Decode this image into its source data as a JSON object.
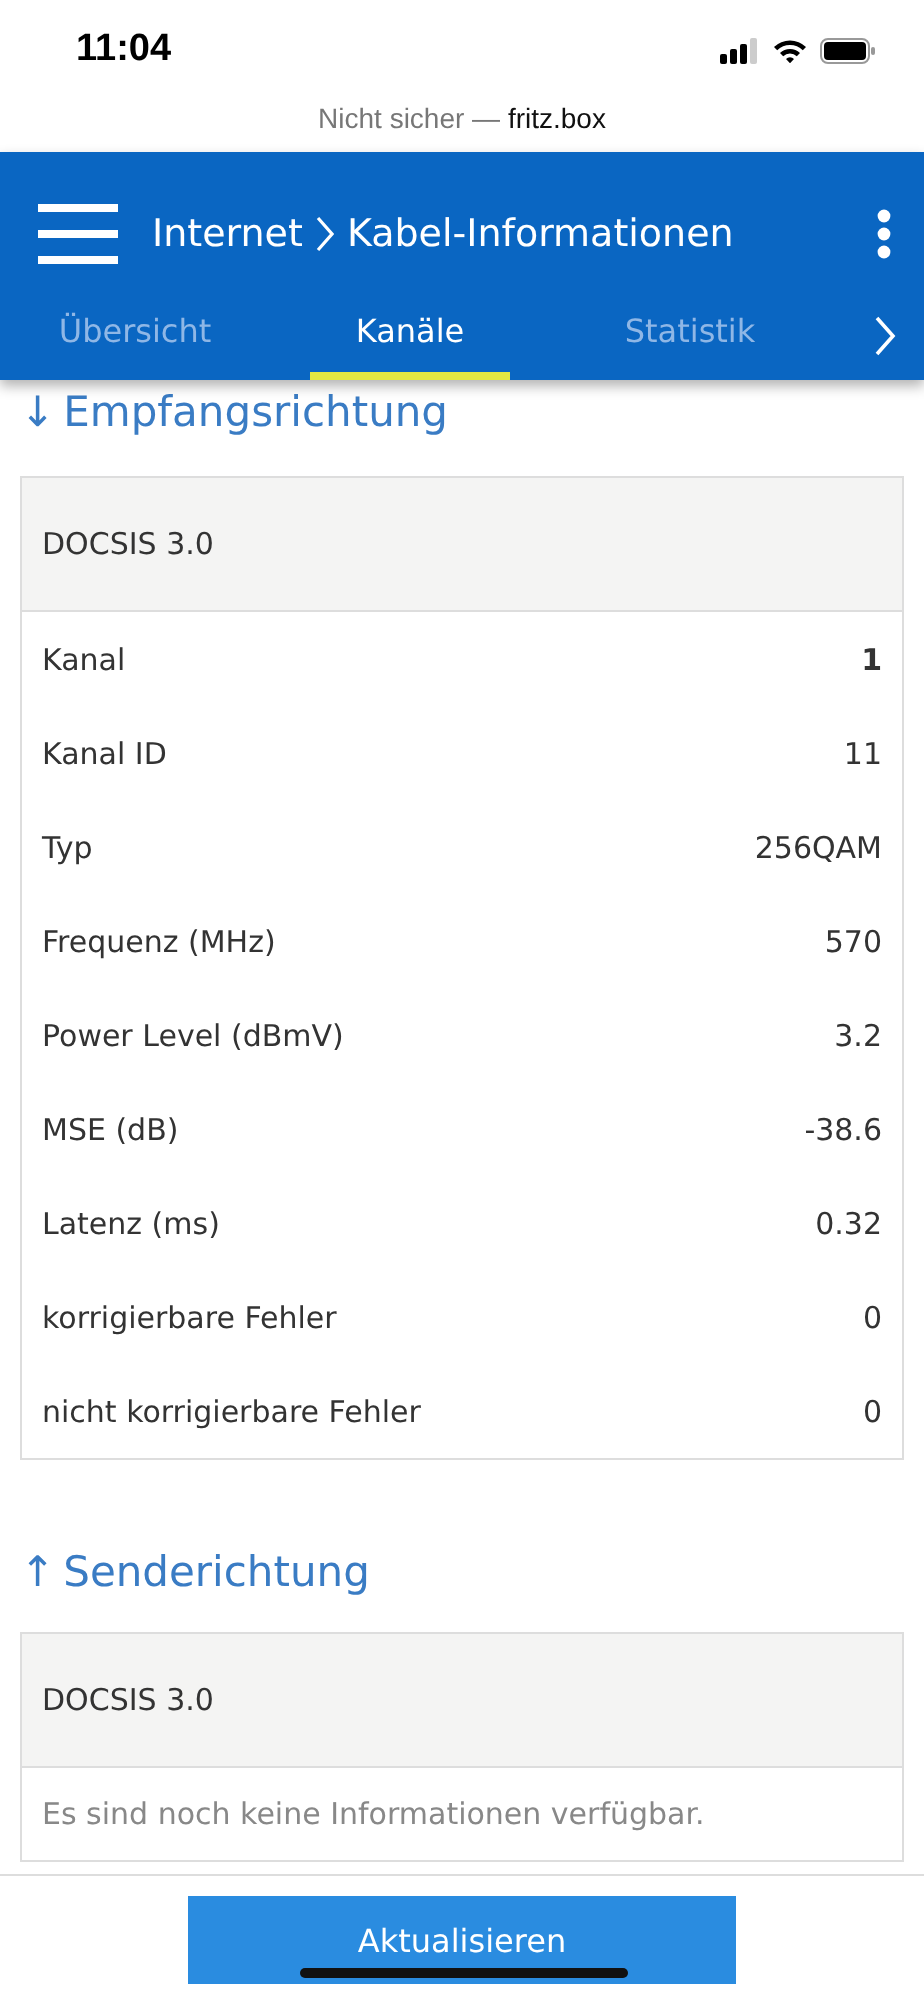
{
  "status_bar": {
    "time": "11:04"
  },
  "url_bar": {
    "prefix": "Nicht sicher —",
    "host": "fritz.box"
  },
  "header": {
    "breadcrumb": [
      "Internet",
      "Kabel-Informationen"
    ]
  },
  "tabs": [
    {
      "label": "Übersicht",
      "selected": false
    },
    {
      "label": "Kanäle",
      "selected": true
    },
    {
      "label": "Statistik",
      "selected": false
    }
  ],
  "sections": [
    {
      "arrow": "↓",
      "title": "Empfangsrichtung",
      "table_title": "DOCSIS 3.0",
      "rows": [
        {
          "label": "Kanal",
          "value": "1",
          "bold": true
        },
        {
          "label": "Kanal ID",
          "value": "11",
          "bold": false
        },
        {
          "label": "Typ",
          "value": "256QAM",
          "bold": false
        },
        {
          "label": "Frequenz (MHz)",
          "value": "570",
          "bold": false
        },
        {
          "label": "Power Level (dBmV)",
          "value": "3.2",
          "bold": false
        },
        {
          "label": "MSE (dB)",
          "value": "-38.6",
          "bold": false
        },
        {
          "label": "Latenz (ms)",
          "value": "0.32",
          "bold": false
        },
        {
          "label": "korrigierbare Fehler",
          "value": "0",
          "bold": false
        },
        {
          "label": "nicht korrigierbare Fehler",
          "value": "0",
          "bold": false
        }
      ]
    },
    {
      "arrow": "↑",
      "title": "Senderichtung",
      "table_title": "DOCSIS 3.0",
      "message": "Es sind noch keine Informationen verfügbar."
    }
  ],
  "button": "Aktualisieren"
}
